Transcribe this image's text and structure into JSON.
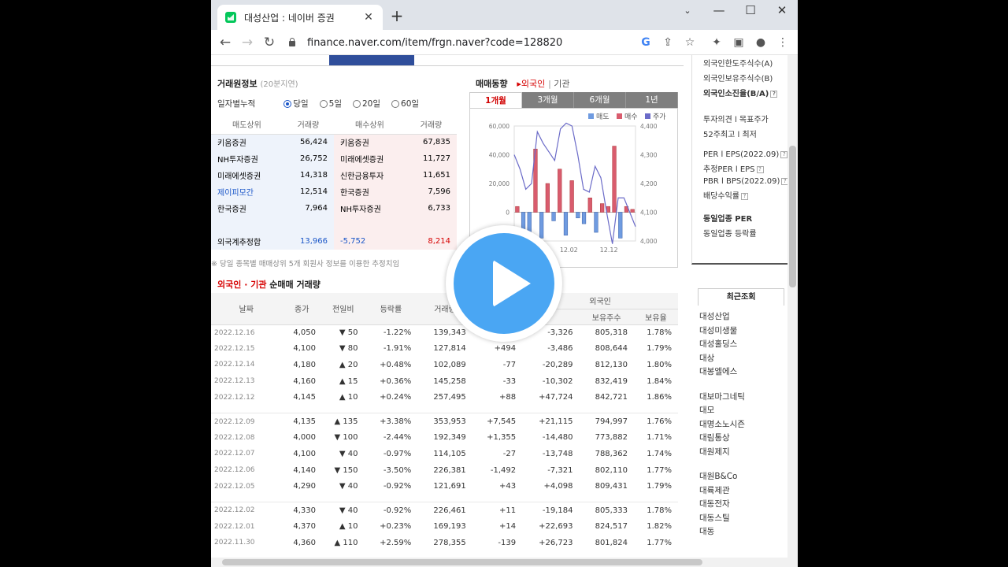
{
  "window": {
    "tab_title": "대성산업 : 네이버 증권",
    "url": "finance.naver.com/item/frgn.naver?code=128820"
  },
  "colors": {
    "accent": "#2f4e9b",
    "up": "#d60000",
    "down": "#1a56c8",
    "play": "#4aa6f3"
  },
  "broker": {
    "title": "거래원정보",
    "delay": "(20분지연)",
    "period_label": "일자별누적",
    "periods": [
      "당일",
      "5일",
      "20일",
      "60일"
    ],
    "selected_period": "당일",
    "headers": [
      "매도상위",
      "거래량",
      "매수상위",
      "거래량"
    ],
    "rows": [
      [
        "키움증권",
        "56,424",
        "키움증권",
        "67,835"
      ],
      [
        "NH투자증권",
        "26,752",
        "미래에셋증권",
        "11,727"
      ],
      [
        "미래에셋증권",
        "14,318",
        "신한금융투자",
        "11,651"
      ],
      [
        "제이피모간",
        "12,514",
        "한국증권",
        "7,596"
      ],
      [
        "한국증권",
        "7,964",
        "NH투자증권",
        "6,733"
      ]
    ],
    "foreign": {
      "label": "외국계추정합",
      "sell": "13,966",
      "net": "-5,752",
      "buy": "8,214"
    },
    "note": "※ 당일 종목별 매매상위 5개 회원사 정보를 이용한 추정치임"
  },
  "trend": {
    "title": "매매동향",
    "links": [
      "외국인",
      "기관"
    ],
    "tabs": [
      "1개월",
      "3개월",
      "6개월",
      "1년"
    ],
    "active_tab": "1개월",
    "legend": [
      "매도",
      "매수",
      "주가"
    ]
  },
  "chart_data": {
    "type": "bar",
    "series": [
      {
        "name": "매도",
        "color": "#6f9be0"
      },
      {
        "name": "매수",
        "color": "#d95c6e"
      },
      {
        "name": "주가",
        "color": "#6b6bc8"
      }
    ],
    "bars": [
      4,
      -12,
      -22,
      44,
      -18,
      20,
      -6,
      30,
      -16,
      22,
      -4,
      -8,
      10,
      -14,
      6,
      4,
      46,
      -18,
      4,
      2
    ],
    "price": [
      4300,
      4250,
      4180,
      4200,
      4380,
      4340,
      4310,
      4280,
      4390,
      4410,
      4400,
      4300,
      4180,
      4170,
      4260,
      4220,
      4100,
      3990,
      4150,
      4150,
      4100,
      4050
    ],
    "ylim_left": [
      -20000,
      60000
    ],
    "ylim_right": [
      4000,
      4400
    ],
    "left_ticks": [
      "60,000",
      "40,000",
      "20,000",
      "0",
      "-20,000"
    ],
    "right_ticks": [
      "4,400",
      "4,300",
      "4,200",
      "4,100",
      "4,000"
    ],
    "x_ticks": [
      "12.02",
      "12.12"
    ]
  },
  "net": {
    "title_a": "외국인 · 기관",
    "title_b": "순매매 거래량",
    "group_header": "외국인",
    "headers": [
      "날짜",
      "종가",
      "전일비",
      "등락률",
      "거래량",
      "",
      "",
      "보유주수",
      "보유율"
    ],
    "rows": [
      [
        "2022.12.16",
        "4,050",
        "down",
        "50",
        "-1.22%",
        "139,343",
        "",
        "-3,326",
        "805,318",
        "1.78%"
      ],
      [
        "2022.12.15",
        "4,100",
        "down",
        "80",
        "-1.91%",
        "127,814",
        "+494",
        "-3,486",
        "808,644",
        "1.79%"
      ],
      [
        "2022.12.14",
        "4,180",
        "up",
        "20",
        "+0.48%",
        "102,089",
        "-77",
        "-20,289",
        "812,130",
        "1.80%"
      ],
      [
        "2022.12.13",
        "4,160",
        "up",
        "15",
        "+0.36%",
        "145,258",
        "-33",
        "-10,302",
        "832,419",
        "1.84%"
      ],
      [
        "2022.12.12",
        "4,145",
        "up",
        "10",
        "+0.24%",
        "257,495",
        "+88",
        "+47,724",
        "842,721",
        "1.86%"
      ],
      [
        "2022.12.09",
        "4,135",
        "up",
        "135",
        "+3.38%",
        "353,953",
        "+7,545",
        "+21,115",
        "794,997",
        "1.76%"
      ],
      [
        "2022.12.08",
        "4,000",
        "down",
        "100",
        "-2.44%",
        "192,349",
        "+1,355",
        "-14,480",
        "773,882",
        "1.71%"
      ],
      [
        "2022.12.07",
        "4,100",
        "down",
        "40",
        "-0.97%",
        "114,105",
        "-27",
        "-13,748",
        "788,362",
        "1.74%"
      ],
      [
        "2022.12.06",
        "4,140",
        "down",
        "150",
        "-3.50%",
        "226,381",
        "-1,492",
        "-7,321",
        "802,110",
        "1.77%"
      ],
      [
        "2022.12.05",
        "4,290",
        "down",
        "40",
        "-0.92%",
        "121,691",
        "+43",
        "+4,098",
        "809,431",
        "1.79%"
      ],
      [
        "2022.12.02",
        "4,330",
        "down",
        "40",
        "-0.92%",
        "226,461",
        "+11",
        "-19,184",
        "805,333",
        "1.78%"
      ],
      [
        "2022.12.01",
        "4,370",
        "up",
        "10",
        "+0.23%",
        "169,193",
        "+14",
        "+22,693",
        "824,517",
        "1.82%"
      ],
      [
        "2022.11.30",
        "4,360",
        "up",
        "110",
        "+2.59%",
        "278,355",
        "-139",
        "+26,723",
        "801,824",
        "1.77%"
      ]
    ]
  },
  "sidebar": {
    "top": [
      "외국인한도주식수(A)",
      "외국인보유주식수(B)",
      "외국인소진율(B/A)"
    ],
    "mid": [
      "투자의견 l 목표주가",
      "52주최고 l 최저"
    ],
    "per": [
      "PER l EPS(2022.09)",
      "추정PER l EPS",
      "PBR l BPS(2022.09)",
      "배당수익률"
    ],
    "industry": [
      "동일업종 PER",
      "동일업종 등락률"
    ],
    "recent_title": "최근조회",
    "recent": [
      "대성산업",
      "대성미생물",
      "대성홀딩스",
      "대상",
      "대봉엘에스",
      "대보마그네틱",
      "대모",
      "대명소노시즌",
      "대림통상",
      "대원제지",
      "대원B&Co",
      "대륙제관",
      "대동전자",
      "대동스틸",
      "대동"
    ]
  }
}
